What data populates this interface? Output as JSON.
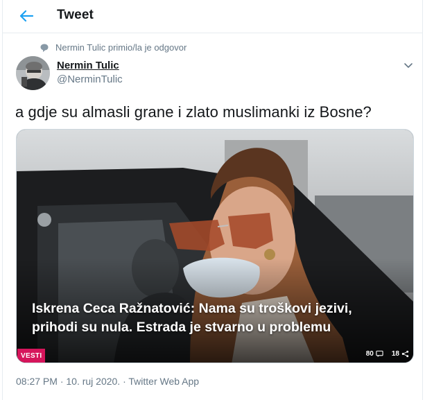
{
  "header": {
    "title": "Tweet"
  },
  "reply_note": "Nermin Tulic primio/la je odgovor",
  "author": {
    "name": "Nermin Tulic",
    "handle": "@NerminTulic"
  },
  "tweet": {
    "text": "a gdje su almasli grane i zlato muslimanki iz Bosne?"
  },
  "card": {
    "headline_line1": "Iskrena Ceca Ražnatović: Nama su troškovi jezivi,",
    "headline_line2": "prihodi su nula. Estrada je stvarno u problemu",
    "badge": "VESTI",
    "comments_count": "80",
    "shares_count": "18"
  },
  "meta": {
    "timestamp": "08:27 PM · 10. ruj 2020. · Twitter Web App"
  },
  "colors": {
    "accent": "#1da1f2",
    "muted": "#657786",
    "badge": "#d6155b",
    "border": "#e6ecf0"
  },
  "icons": [
    "back-arrow-icon",
    "reply-bubble-icon",
    "chevron-down-icon",
    "comment-icon",
    "share-icon"
  ]
}
